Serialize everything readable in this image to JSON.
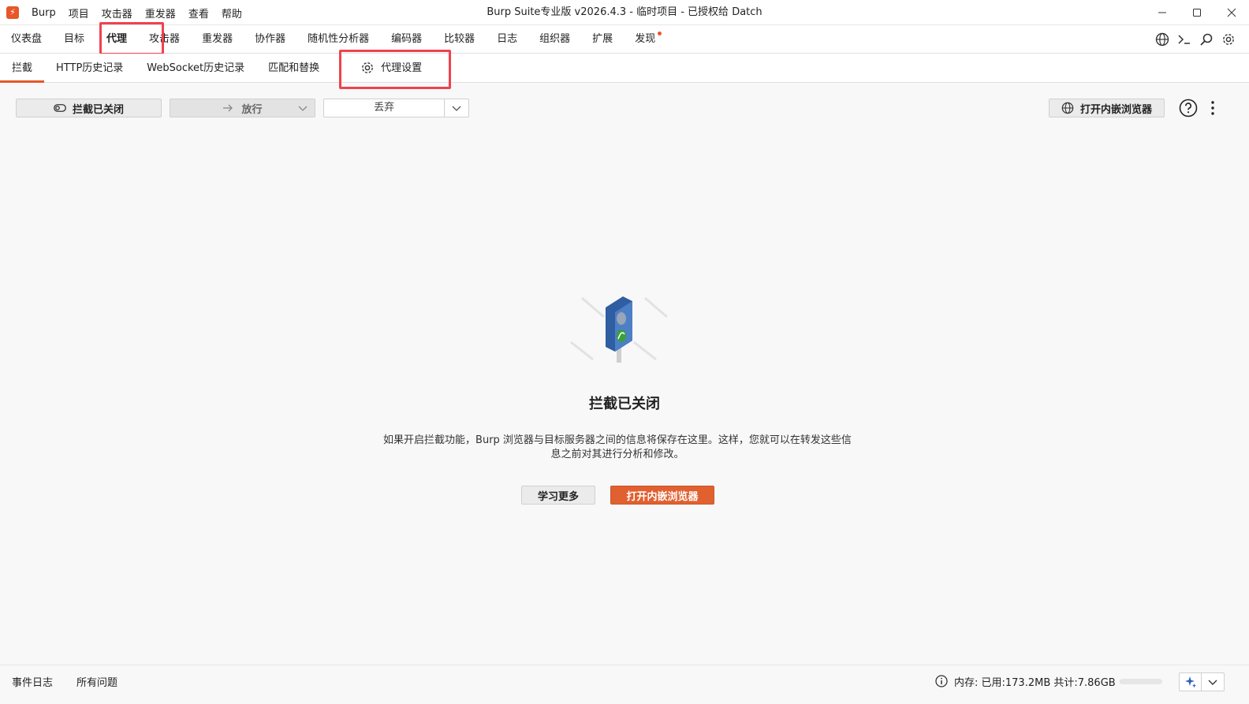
{
  "app": {
    "logo_glyph": "⚡",
    "window_title": "Burp Suite专业版  v2026.4.3 - 临时项目 - 已授权给 Datch",
    "menu": [
      "Burp",
      "项目",
      "攻击器",
      "重发器",
      "查看",
      "帮助"
    ]
  },
  "top_tabs": [
    {
      "label": "仪表盘"
    },
    {
      "label": "目标"
    },
    {
      "label": "代理",
      "active": true
    },
    {
      "label": "攻击器"
    },
    {
      "label": "重发器"
    },
    {
      "label": "协作器"
    },
    {
      "label": "随机性分析器"
    },
    {
      "label": "编码器"
    },
    {
      "label": "比较器"
    },
    {
      "label": "日志"
    },
    {
      "label": "组织器"
    },
    {
      "label": "扩展"
    },
    {
      "label": "发现",
      "notification": true
    }
  ],
  "sub_tabs": [
    {
      "label": "拦截",
      "active": true
    },
    {
      "label": "HTTP历史记录"
    },
    {
      "label": "WebSocket历史记录"
    },
    {
      "label": "匹配和替换"
    }
  ],
  "proxy_settings_label": "代理设置",
  "intercept_toolbar": {
    "intercept_toggle_label": "拦截已关闭",
    "forward_label": "放行",
    "drop_label": "丢弃",
    "open_browser_label": "打开内嵌浏览器"
  },
  "empty_state": {
    "title": "拦截已关闭",
    "description": "如果开启拦截功能，Burp 浏览器与目标服务器之间的信息将保存在这里。这样，您就可以在转发这些信息之前对其进行分析和修改。",
    "learn_more_label": "学习更多",
    "open_browser_label": "打开内嵌浏览器"
  },
  "status_bar": {
    "event_log_label": "事件日志",
    "all_issues_label": "所有问题",
    "memory_text": "内存: 已用:173.2MB 共计:7.86GB",
    "memory_used_fraction": 0.022
  },
  "colors": {
    "accent": "#e8562a",
    "highlight_box": "#f0424e",
    "primary_button": "#e06030"
  }
}
